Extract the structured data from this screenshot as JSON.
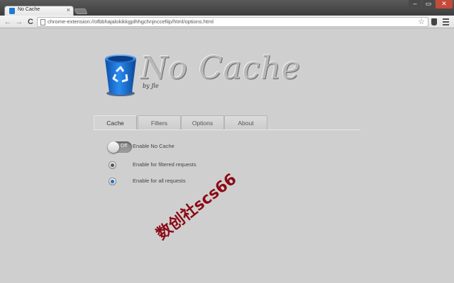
{
  "browser": {
    "tab_title": "No Cache",
    "tab_close": "×",
    "url": "chrome-extension://ofbbhajalokikkgplhhgchnjnccefiip/html/options.html",
    "window_controls": {
      "minimize": "‒",
      "maximize": "▭",
      "close": "✕"
    },
    "nav": {
      "back": "←",
      "forward": "→",
      "reload": "C"
    },
    "bookmark_star": "☆"
  },
  "header": {
    "title": "No Cache",
    "byline": "by Jle"
  },
  "tabs": [
    {
      "label": "Cache",
      "active": true
    },
    {
      "label": "Filters",
      "active": false
    },
    {
      "label": "Options",
      "active": false
    },
    {
      "label": "About",
      "active": false
    }
  ],
  "options": {
    "enable": {
      "toggle_text": "Off",
      "label": "Enable No Cache",
      "state": "off"
    },
    "filtered": {
      "label": "Enable for filtered requests",
      "selected": false
    },
    "all": {
      "label": "Enable for all requests",
      "selected": true
    }
  },
  "watermark": "数创社scs66",
  "colors": {
    "accent": "#1c6fd0",
    "watermark": "#8b0a14",
    "page_bg": "#cfcfcf"
  }
}
